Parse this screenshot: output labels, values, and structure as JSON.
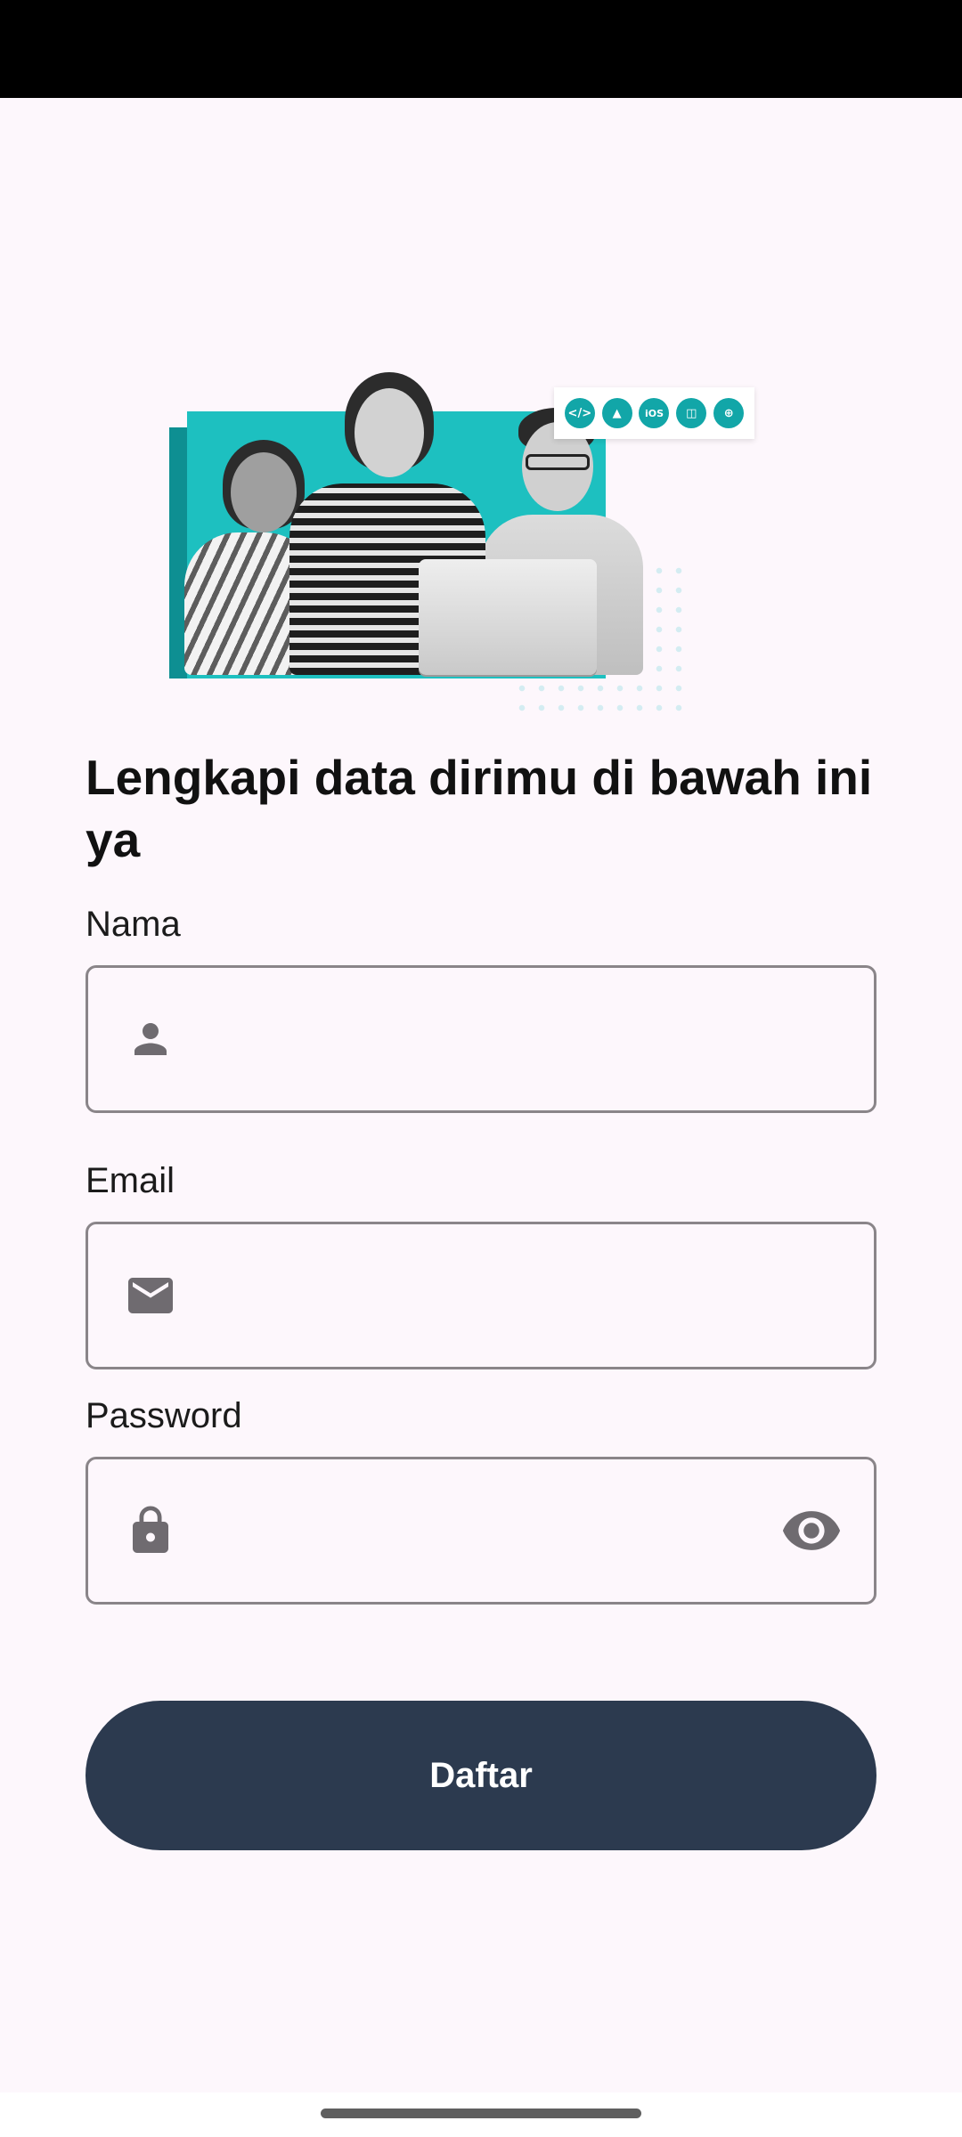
{
  "status_bar": {},
  "hero": {
    "tech_icons": [
      {
        "icon": "code-icon",
        "glyph": "</>"
      },
      {
        "icon": "android-icon",
        "glyph": "▲"
      },
      {
        "icon": "ios-icon",
        "glyph": "iOS"
      },
      {
        "icon": "multiplatform-icon",
        "glyph": "◫"
      },
      {
        "icon": "web-globe-icon",
        "glyph": "⊕"
      }
    ],
    "accent_color": "#1dc0c0"
  },
  "form": {
    "title": "Lengkapi data dirimu di bawah ini ya",
    "name": {
      "label": "Nama",
      "value": "",
      "placeholder": "",
      "icon": "person-icon"
    },
    "email": {
      "label": "Email",
      "value": "",
      "placeholder": "",
      "icon": "mail-icon"
    },
    "password": {
      "label": "Password",
      "value": "",
      "placeholder": "",
      "icon": "lock-icon",
      "toggle_icon": "eye-icon"
    },
    "submit_label": "Daftar"
  },
  "colors": {
    "background": "#fdf7fc",
    "button": "#2c3a4f",
    "outline": "#8a8589",
    "icon": "#6f6b70"
  }
}
